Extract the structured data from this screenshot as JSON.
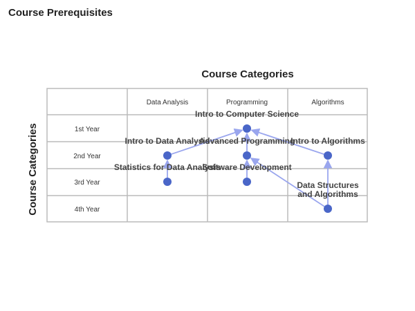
{
  "page_title": "Course Prerequisites",
  "diagram": {
    "top_title": "Course Categories",
    "side_title": "Course Categories",
    "columns": [
      "Data Analysis",
      "Programming",
      "Algorithms"
    ],
    "rows": [
      "1st Year",
      "2nd Year",
      "3rd Year",
      "4th Year"
    ],
    "colors": {
      "node": "#4a66c8",
      "edge": "#9aa6ee",
      "grid": "#bbbbbb"
    },
    "nodes": [
      {
        "id": "cs",
        "label": [
          "Intro to Computer Science"
        ],
        "col": 1,
        "row": 0
      },
      {
        "id": "ida",
        "label": [
          "Intro to Data Analysis"
        ],
        "col": 0,
        "row": 1
      },
      {
        "id": "ap",
        "label": [
          "Advanced Programming"
        ],
        "col": 1,
        "row": 1
      },
      {
        "id": "ia",
        "label": [
          "Intro to Algorithms"
        ],
        "col": 2,
        "row": 1
      },
      {
        "id": "sda",
        "label": [
          "Statistics for Data Analysis"
        ],
        "col": 0,
        "row": 2
      },
      {
        "id": "sd",
        "label": [
          "Software Development"
        ],
        "col": 1,
        "row": 2
      },
      {
        "id": "dsa",
        "label": [
          "Data Structures",
          "and Algorithms"
        ],
        "col": 2,
        "row": 3
      }
    ],
    "edges": [
      {
        "from": "ida",
        "to": "cs"
      },
      {
        "from": "ap",
        "to": "cs"
      },
      {
        "from": "ia",
        "to": "cs"
      },
      {
        "from": "sda",
        "to": "ida"
      },
      {
        "from": "sd",
        "to": "ap"
      },
      {
        "from": "dsa",
        "to": "ap"
      },
      {
        "from": "dsa",
        "to": "ia"
      }
    ]
  }
}
